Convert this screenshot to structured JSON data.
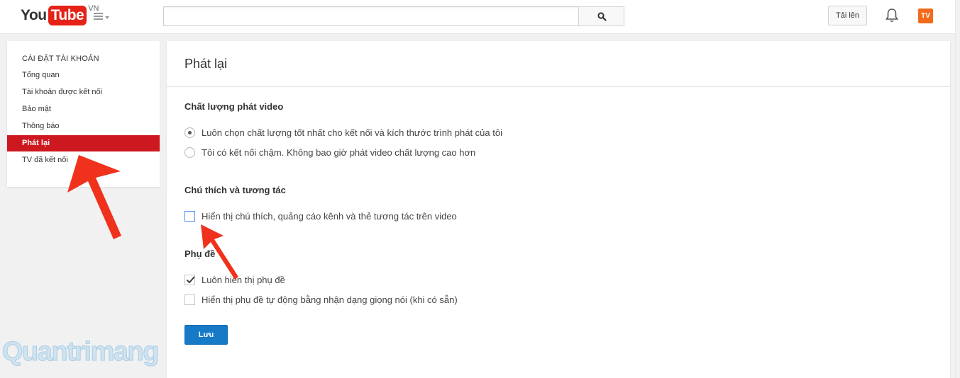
{
  "header": {
    "logo_you": "You",
    "logo_tube": "Tube",
    "logo_country": "VN",
    "search_placeholder": "",
    "upload_label": "Tải lên",
    "avatar_text": "TV"
  },
  "sidebar": {
    "title": "CÀI ĐẶT TÀI KHOẢN",
    "items": [
      {
        "label": "Tổng quan"
      },
      {
        "label": "Tài khoản được kết nối"
      },
      {
        "label": "Bảo mật"
      },
      {
        "label": "Thông báo"
      },
      {
        "label": "Phát lại",
        "active": true
      },
      {
        "label": "TV đã kết nối"
      }
    ]
  },
  "main": {
    "title": "Phát lại",
    "video_quality": {
      "title": "Chất lượng phát video",
      "options": [
        {
          "label": "Luôn chọn chất lượng tốt nhất cho kết nối và kích thước trình phát của tôi",
          "selected": true
        },
        {
          "label": "Tôi có kết nối chậm. Không bao giờ phát video chất lượng cao hơn",
          "selected": false
        }
      ]
    },
    "annotations": {
      "title": "Chú thích và tương tác",
      "options": [
        {
          "label": "Hiển thị chú thích, quảng cáo kênh và thẻ tương tác trên video",
          "checked": false
        }
      ]
    },
    "captions": {
      "title": "Phụ đề",
      "options": [
        {
          "label": "Luôn hiển thị phụ đề",
          "checked": true
        },
        {
          "label": "Hiển thị phụ đề tự động bằng nhận dạng giọng nói (khi có sẵn)",
          "checked": false
        }
      ]
    },
    "save_label": "Lưu"
  },
  "watermark": {
    "text": "Quantrimang"
  },
  "colors": {
    "brand_red": "#cc181e",
    "logo_red": "#e62117",
    "button_blue": "#167ac6",
    "arrow_red": "#f0311c"
  }
}
